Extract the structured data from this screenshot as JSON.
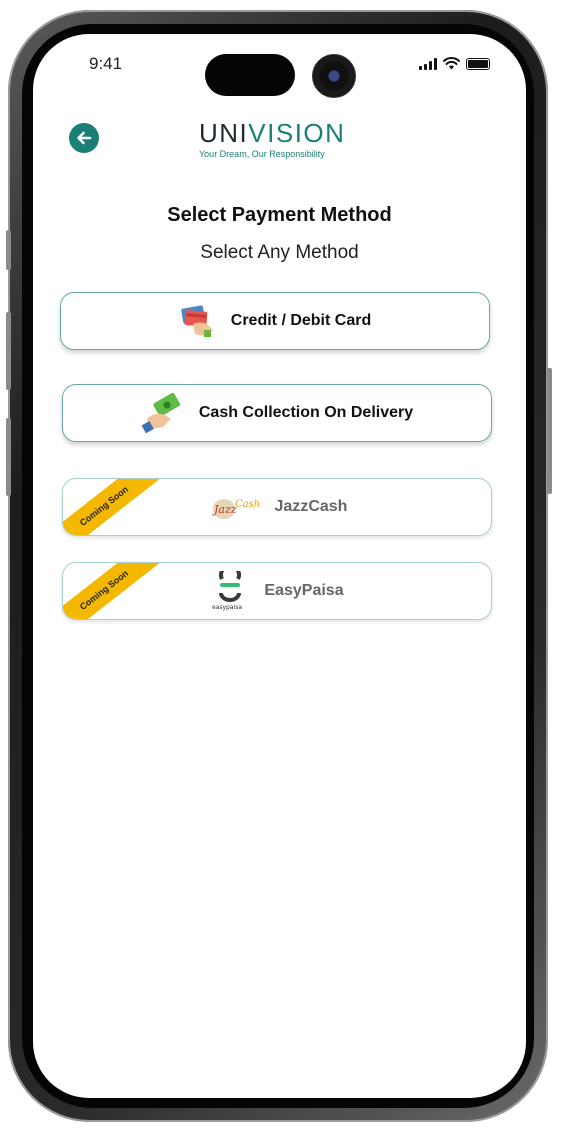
{
  "status_bar": {
    "time": "9:41"
  },
  "header": {
    "logo_part1": "UNI",
    "logo_part2": "VISION",
    "tagline": "Your Dream, Our Responsibility"
  },
  "page": {
    "title": "Select Payment Method",
    "subtitle": "Select Any Method"
  },
  "options": [
    {
      "label": "Credit / Debit Card",
      "icon": "credit-card-hand-icon"
    },
    {
      "label": "Cash Collection On Delivery",
      "icon": "cash-hand-icon"
    },
    {
      "label": "JazzCash",
      "icon": "jazzcash-logo",
      "badge": "Coming Soon",
      "logo_text": "JazzCash"
    },
    {
      "label": "EasyPaisa",
      "icon": "easypaisa-logo",
      "badge": "Coming Soon",
      "logo_text": "easypaisa"
    }
  ],
  "colors": {
    "accent": "#1a7f74",
    "ribbon": "#f5b800",
    "border": "#6aa89f"
  }
}
